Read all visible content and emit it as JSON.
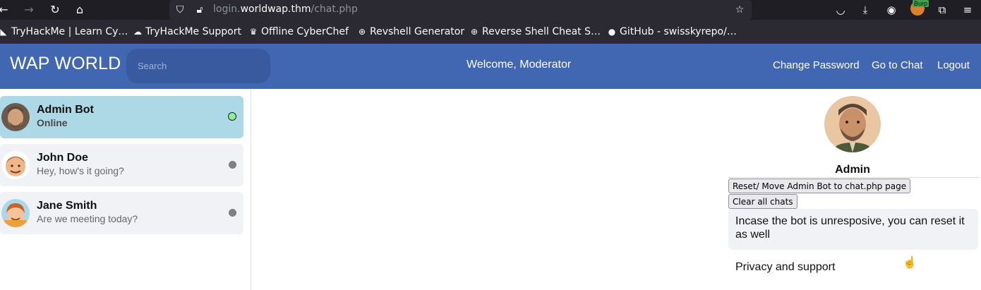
{
  "browser": {
    "url_prefix": "login.",
    "url_host": "worldwap.thm",
    "url_path": "/chat.php",
    "icons": {
      "back": "arrow-left-icon",
      "forward": "arrow-right-icon",
      "reload": "reload-icon",
      "home": "home-icon",
      "shield": "shield-icon",
      "insecure": "lock-slash-icon",
      "bookmark_star": "star-icon",
      "pocket": "pocket-icon",
      "downloads": "download-icon",
      "account": "account-icon",
      "burp": "burp-extension-icon",
      "extensions": "puzzle-icon",
      "menu": "hamburger-menu-icon"
    },
    "burp_label": "Burp"
  },
  "bookmarks": [
    {
      "label": "TryHackMe | Learn Cy…",
      "icon": "tryhackme-icon"
    },
    {
      "label": "TryHackMe Support",
      "icon": "cloud-gear-icon"
    },
    {
      "label": "Offline CyberChef",
      "icon": "chef-hat-icon"
    },
    {
      "label": "Revshell Generator",
      "icon": "globe-icon"
    },
    {
      "label": "Reverse Shell Cheat S…",
      "icon": "globe-icon"
    },
    {
      "label": "GitHub - swisskyrepo/…",
      "icon": "github-icon"
    }
  ],
  "header": {
    "brand": "WAP WORLD",
    "search_placeholder": "Search",
    "welcome": "Welcome, Moderator",
    "links": [
      "Change Password",
      "Go to Chat",
      "Logout"
    ],
    "bg_color": "#4267b2"
  },
  "chats": [
    {
      "name": "Admin Bot",
      "subtitle": "Online",
      "status": "online",
      "active": true
    },
    {
      "name": "John Doe",
      "subtitle": "Hey, how's it going?",
      "status": "offline",
      "active": false
    },
    {
      "name": "Jane Smith",
      "subtitle": "Are we meeting today?",
      "status": "offline",
      "active": false
    }
  ],
  "profile": {
    "name": "Admin",
    "reset_button": "Reset/ Move Admin Bot to chat.php page",
    "clear_button": "Clear all chats",
    "note": "Incase the bot is unresposive, you can reset it as well",
    "privacy": "Privacy and support"
  }
}
